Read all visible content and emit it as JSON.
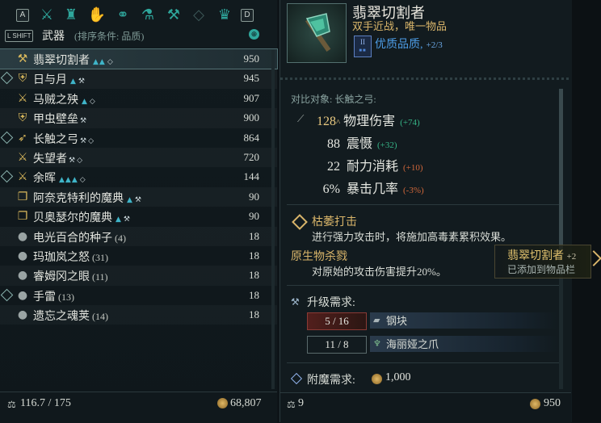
{
  "categories": {
    "left_key": "A",
    "right_key": "D",
    "tabs": [
      {
        "icon": "crossed-swords-icon",
        "glyph": "⚔"
      },
      {
        "icon": "armor-icon",
        "glyph": "♜"
      },
      {
        "icon": "gauntlet-icon",
        "glyph": "✋"
      },
      {
        "icon": "rings-icon",
        "glyph": "⚭"
      },
      {
        "icon": "potion-bag-icon",
        "glyph": "⚗"
      },
      {
        "icon": "anvil-icon",
        "glyph": "⚒"
      },
      {
        "icon": "gem-icon",
        "glyph": "◇"
      },
      {
        "icon": "crown-icon",
        "glyph": "♛"
      }
    ]
  },
  "header": {
    "shift_key": "L SHIFT",
    "title": "武器",
    "sort_label": "(排序条件: 品质)"
  },
  "items": [
    {
      "name": "翡翠切割者",
      "marks": "▲▲",
      "diamond": "◇",
      "value": "950",
      "selected": true,
      "equipped": false,
      "icon": "⚒",
      "count": ""
    },
    {
      "name": "日与月",
      "marks": "▲",
      "diamond": "",
      "value": "945",
      "selected": false,
      "equipped": true,
      "icon": "⛨",
      "count": ""
    },
    {
      "name": "马贼之殃",
      "marks": "▲",
      "diamond": "◇",
      "value": "907",
      "selected": false,
      "equipped": false,
      "icon": "⚔",
      "count": ""
    },
    {
      "name": "甲虫壁垒",
      "marks": "",
      "diamond": "",
      "value": "900",
      "selected": false,
      "equipped": false,
      "icon": "⛨",
      "count": ""
    },
    {
      "name": "长触之弓",
      "marks": "",
      "diamond": "◇",
      "value": "864",
      "selected": false,
      "equipped": true,
      "icon": "➶",
      "count": ""
    },
    {
      "name": "失望者",
      "marks": "",
      "diamond": "◇",
      "value": "720",
      "selected": false,
      "equipped": false,
      "icon": "⚔",
      "count": ""
    },
    {
      "name": "余晖",
      "marks": "▲▲▲",
      "diamond": "◇",
      "value": "144",
      "selected": false,
      "equipped": true,
      "icon": "⚔",
      "count": ""
    },
    {
      "name": "阿奈克特利的魔典",
      "marks": "▲",
      "diamond": "",
      "value": "90",
      "selected": false,
      "equipped": false,
      "icon": "❐",
      "count": ""
    },
    {
      "name": "贝奥瑟尔的魔典",
      "marks": "▲",
      "diamond": "",
      "value": "90",
      "selected": false,
      "equipped": false,
      "icon": "❐",
      "count": ""
    },
    {
      "name": "电光百合的种子",
      "marks": "",
      "diamond": "",
      "value": "18",
      "selected": false,
      "equipped": false,
      "icon": "●",
      "count": "(4)"
    },
    {
      "name": "玛珈岚之怒",
      "marks": "",
      "diamond": "",
      "value": "18",
      "selected": false,
      "equipped": false,
      "icon": "●",
      "count": "(31)"
    },
    {
      "name": "睿姆冈之眼",
      "marks": "",
      "diamond": "",
      "value": "18",
      "selected": false,
      "equipped": false,
      "icon": "●",
      "count": "(11)"
    },
    {
      "name": "手雷",
      "marks": "",
      "diamond": "",
      "value": "18",
      "selected": false,
      "equipped": true,
      "icon": "●",
      "count": "(13)"
    },
    {
      "name": "遗忘之魂荚",
      "marks": "",
      "diamond": "",
      "value": "18",
      "selected": false,
      "equipped": false,
      "icon": "●",
      "count": "(14)"
    }
  ],
  "left_footer": {
    "weight": "116.7 / 175",
    "gold": "68,807"
  },
  "detail": {
    "name": "翡翠切割者",
    "type": "双手近战，唯一物品",
    "tier": "II",
    "quality": "优质品质,",
    "quality_level": "+2/3",
    "compare": "对比对象:  长触之弓:",
    "stats": [
      {
        "value": "128",
        "suffix": "^",
        "label": "物理伤害",
        "delta": "(+74)",
        "dir": "up"
      },
      {
        "value": "88",
        "suffix": "",
        "label": "震慑",
        "delta": "(+32)",
        "dir": "up"
      },
      {
        "value": "22",
        "suffix": "",
        "label": "耐力消耗",
        "delta": "(+10)",
        "dir": "down"
      },
      {
        "value": "6%",
        "suffix": "",
        "label": "暴击几率",
        "delta": "(-3%)",
        "dir": "down"
      }
    ],
    "skill_name": "枯萎打击",
    "skill_desc": "进行强力攻击时，将施加高毒素累积效果。",
    "perk_name": "原生物杀戮",
    "perk_desc": "对原始的攻击伤害提升20%。",
    "upgrade_title": "升级需求:",
    "materials": [
      {
        "have": "5 / 16",
        "name": "钢块",
        "insufficient": true
      },
      {
        "have": "11 / 8",
        "name": "海丽娅之爪",
        "insufficient": false
      }
    ],
    "enchant_title": "附魔需求:",
    "enchant_cost": "1,000"
  },
  "right_footer": {
    "count": "9",
    "gold": "950"
  },
  "tooltip": {
    "name": "翡翠切割者",
    "level": "+2",
    "note": "已添加到物品栏"
  },
  "colors": {
    "accent": "#2fa79c",
    "gold": "#d9b56a",
    "quality_blue": "#4c9be4",
    "up": "#36b587",
    "down": "#d0673a"
  }
}
